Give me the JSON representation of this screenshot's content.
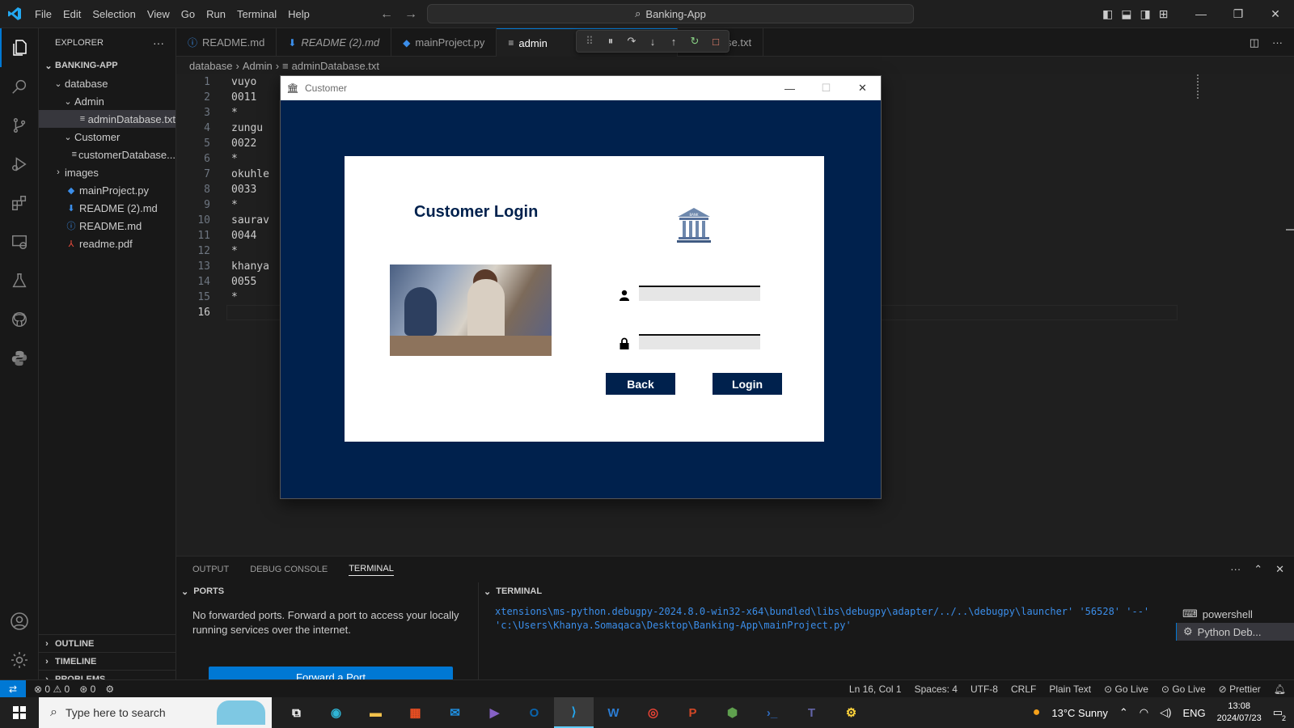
{
  "titlebar": {
    "menu": [
      "File",
      "Edit",
      "Selection",
      "View",
      "Go",
      "Run",
      "Terminal",
      "Help"
    ],
    "search": "Banking-App"
  },
  "sidebar": {
    "header": "EXPLORER",
    "root": "BANKING-APP",
    "tree": [
      {
        "label": "database",
        "indent": 1,
        "chev": "⌄",
        "icon": ""
      },
      {
        "label": "Admin",
        "indent": 2,
        "chev": "⌄",
        "icon": ""
      },
      {
        "label": "adminDatabase.txt",
        "indent": 3,
        "chev": "",
        "icon": "≡",
        "selected": true
      },
      {
        "label": "Customer",
        "indent": 2,
        "chev": "⌄",
        "icon": ""
      },
      {
        "label": "customerDatabase...",
        "indent": 3,
        "chev": "",
        "icon": "≡"
      },
      {
        "label": "images",
        "indent": 1,
        "chev": "›",
        "icon": ""
      },
      {
        "label": "mainProject.py",
        "indent": 1,
        "chev": "",
        "icon": "◆"
      },
      {
        "label": "README (2).md",
        "indent": 1,
        "chev": "",
        "icon": "⬇"
      },
      {
        "label": "README.md",
        "indent": 1,
        "chev": "",
        "icon": "ⓘ"
      },
      {
        "label": "readme.pdf",
        "indent": 1,
        "chev": "",
        "icon": "⅄"
      }
    ],
    "sections": [
      "OUTLINE",
      "TIMELINE",
      "PROBLEMS"
    ]
  },
  "tabs": [
    {
      "label": "README.md",
      "icon": "ⓘ",
      "italic": false
    },
    {
      "label": "README (2).md",
      "icon": "⬇",
      "italic": true
    },
    {
      "label": "mainProject.py",
      "icon": "◆",
      "italic": false
    },
    {
      "label": "admin",
      "icon": "≡",
      "italic": false,
      "active": true
    },
    {
      "label": "rDatabase.txt",
      "icon": "",
      "italic": false
    }
  ],
  "breadcrumb": [
    "database",
    "Admin",
    "adminDatabase.txt"
  ],
  "editor": {
    "lines": [
      "vuyo",
      "0011",
      "*",
      "zungu",
      "0022",
      "*",
      "okuhle",
      "0033",
      "*",
      "saurav",
      "0044",
      "*",
      "khanya",
      "0055",
      "*",
      ""
    ],
    "current_line": 16
  },
  "panel": {
    "tabs": [
      "OUTPUT",
      "DEBUG CONSOLE",
      "TERMINAL"
    ],
    "active_tab": "TERMINAL",
    "ports_header": "PORTS",
    "ports_message": "No forwarded ports. Forward a port to access your locally running services over the internet.",
    "forward_button": "Forward a Port",
    "terminal_header": "TERMINAL",
    "terminal_output": "xtensions\\ms-python.debugpy-2024.8.0-win32-x64\\bundled\\libs\\debugpy\\adapter/../..\\debugpy\\launcher' '56528' '--' 'c:\\Users\\Khanya.Somaqaca\\Desktop\\Banking-App\\mainProject.py'",
    "terminals": [
      "powershell",
      "Python Deb..."
    ]
  },
  "statusbar": {
    "errors": "0",
    "warnings": "0",
    "ports": "0",
    "position": "Ln 16, Col 1",
    "spaces": "Spaces: 4",
    "encoding": "UTF-8",
    "eol": "CRLF",
    "language": "Plain Text",
    "golive1": "Go Live",
    "golive2": "Go Live",
    "prettier": "Prettier"
  },
  "app_window": {
    "title": "Customer",
    "heading": "Customer Login",
    "username_value": "",
    "password_value": "",
    "back_label": "Back",
    "login_label": "Login",
    "bank_label": "BANK",
    "accent": "#00214d"
  },
  "taskbar": {
    "search_placeholder": "Type here to search",
    "weather": "13°C  Sunny",
    "lang": "ENG",
    "time": "13:08",
    "date": "2024/07/23",
    "notifications": "2"
  }
}
